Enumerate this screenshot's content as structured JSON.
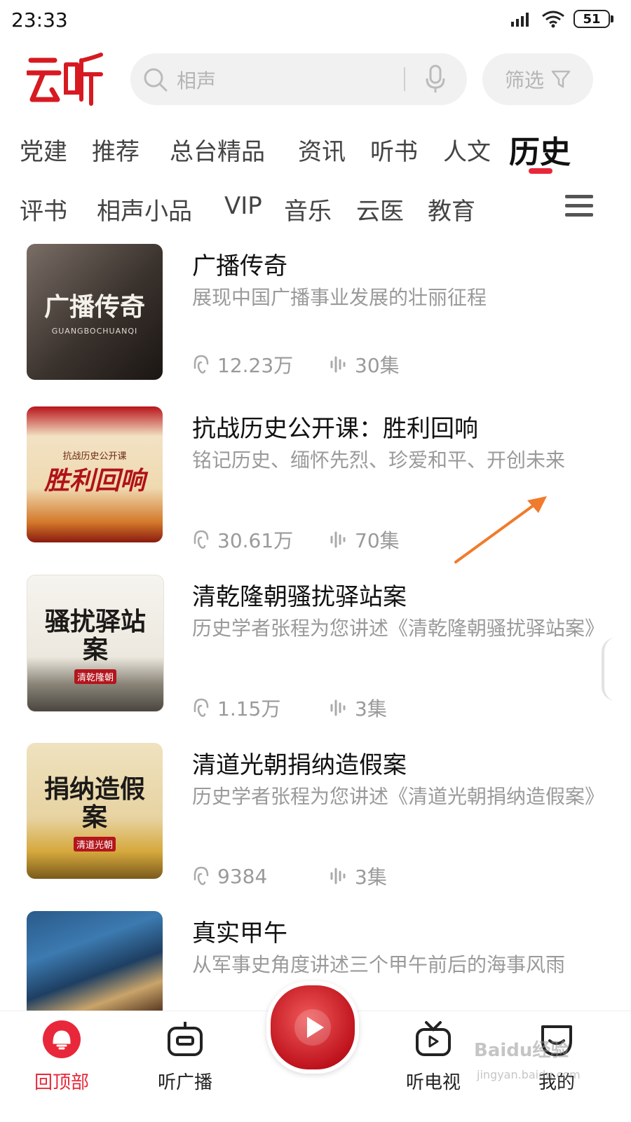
{
  "status_bar": {
    "time": "23:33",
    "battery": "51"
  },
  "header": {
    "logo_text": "云听",
    "search": {
      "placeholder": "相声"
    },
    "filter_label": "筛选"
  },
  "tabs_row1": [
    "党建",
    "推荐",
    "总台精品",
    "资讯",
    "听书",
    "人文",
    "历史"
  ],
  "active_tab": "历史",
  "tabs_row2": [
    "评书",
    "相声小品",
    "VIP",
    "音乐",
    "云医",
    "教育"
  ],
  "items": [
    {
      "title": "广播传奇",
      "desc": "展现中国广播事业发展的壮丽征程",
      "plays": "12.23万",
      "episodes": "30集",
      "cover_text": "广播传奇",
      "cover_sub": "GUANGBOCHUANQI"
    },
    {
      "title": "抗战历史公开课：胜利回响",
      "desc": "铭记历史、缅怀先烈、珍爱和平、开创未来",
      "plays": "30.61万",
      "episodes": "70集",
      "cover_text": "胜利回响",
      "cover_sub": "抗战历史公开课"
    },
    {
      "title": "清乾隆朝骚扰驿站案",
      "desc": "历史学者张程为您讲述《清乾隆朝骚扰驿站案》",
      "plays": "1.15万",
      "episodes": "3集",
      "cover_text": "骚扰驿站案",
      "cover_sub": "清乾隆朝"
    },
    {
      "title": "清道光朝捐纳造假案",
      "desc": "历史学者张程为您讲述《清道光朝捐纳造假案》",
      "plays": "9384",
      "episodes": "3集",
      "cover_text": "捐纳造假案",
      "cover_sub": "清道光朝"
    },
    {
      "title": "真实甲午",
      "desc": "从军事史角度讲述三个甲午前后的海事风雨",
      "plays": "",
      "episodes": "",
      "cover_text": "",
      "cover_sub": ""
    }
  ],
  "bottom_nav": [
    {
      "label": "回顶部",
      "icon": "back-to-top-icon"
    },
    {
      "label": "听广播",
      "icon": "radio-icon"
    },
    {
      "label": "听电视",
      "icon": "tv-icon"
    },
    {
      "label": "我的",
      "icon": "profile-icon"
    }
  ],
  "watermark": {
    "main": "Baidu经验",
    "sub": "jingyan.baidu.com"
  },
  "colors": {
    "accent": "#e8283a",
    "muted": "#9a9a9a"
  }
}
